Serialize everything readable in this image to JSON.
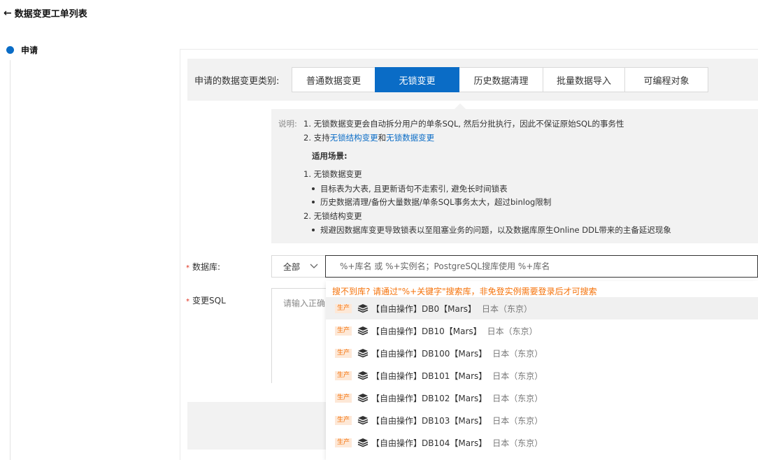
{
  "header": {
    "back_icon": "left-arrow-icon",
    "title": "数据变更工单列表"
  },
  "steps": [
    {
      "label": "申请"
    }
  ],
  "type_selector": {
    "label": "申请的数据变更类别:",
    "tabs": [
      {
        "label": "普通数据变更",
        "active": false
      },
      {
        "label": "无锁变更",
        "active": true
      },
      {
        "label": "历史数据清理",
        "active": false
      },
      {
        "label": "批量数据导入",
        "active": false
      },
      {
        "label": "可编程对象",
        "active": false
      }
    ]
  },
  "description": {
    "prefix": "说明:",
    "line1": "1. 无锁数据变更会自动拆分用户的单条SQL, 然后分批执行，因此不保证原始SQL的事务性",
    "line2_prefix": "2. 支持",
    "line2_link1": "无锁结构变更",
    "line2_mid": "和",
    "line2_link2": "无锁数据变更",
    "scenarios_title": "适用场景:",
    "s1_title": "1. 无锁数据变更",
    "s1_b1": "目标表为大表, 且更新语句不走索引, 避免长时间锁表",
    "s1_b2": "历史数据清理/备份大量数据/单条SQL事务太大，超过binlog限制",
    "s2_title": "2. 无锁结构变更",
    "s2_b1": "规避因数据库变更导致锁表以至阻塞业务的问题，以及数据库原生Online DDL带来的主备延迟现象"
  },
  "database_field": {
    "required_mark": "*",
    "label": "数据库:",
    "scope_value": "全部",
    "search_placeholder": "%+库名 或 %+实例名；PostgreSQL搜库使用 %+库名"
  },
  "sql_field": {
    "required_mark": "*",
    "label": "变更SQL",
    "placeholder": "请输入正确"
  },
  "dropdown": {
    "hint": "搜不到库? 请通过\"%+关键字\"搜索库，非免登实例需要登录后才可搜索",
    "items": [
      {
        "tag": "生产",
        "name": "【自由操作】DB0【Mars】",
        "region": "日本（东京）"
      },
      {
        "tag": "生产",
        "name": "【自由操作】DB10【Mars】",
        "region": "日本（东京）"
      },
      {
        "tag": "生产",
        "name": "【自由操作】DB100【Mars】",
        "region": "日本（东京）"
      },
      {
        "tag": "生产",
        "name": "【自由操作】DB101【Mars】",
        "region": "日本（东京）"
      },
      {
        "tag": "生产",
        "name": "【自由操作】DB102【Mars】",
        "region": "日本（东京）"
      },
      {
        "tag": "生产",
        "name": "【自由操作】DB103【Mars】",
        "region": "日本（东京）"
      },
      {
        "tag": "生产",
        "name": "【自由操作】DB104【Mars】",
        "region": "日本（东京）"
      }
    ]
  },
  "colors": {
    "accent": "#0a6cc6",
    "warning": "#f5720a",
    "required": "#e0301e"
  }
}
